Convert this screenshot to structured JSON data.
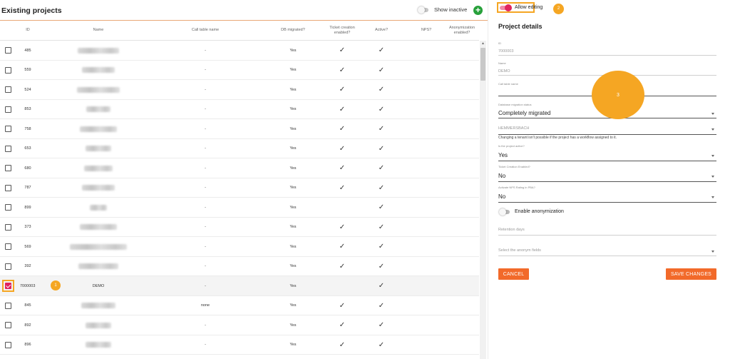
{
  "left": {
    "title": "Existing projects",
    "show_inactive_label": "Show inactive",
    "add_symbol": "+",
    "columns": {
      "id": "ID",
      "name": "Name",
      "call_table": "Call table name",
      "db_migrated": "DB migrated?",
      "ticket": "Ticket creation enabled?",
      "active": "Active?",
      "nps": "NPS?",
      "anonymization": "Anonymization enabled?"
    },
    "rows": [
      {
        "id": "485",
        "name": "",
        "blur_w": 58,
        "call_table": "-",
        "db": "Yes",
        "ticket": true,
        "active": true
      },
      {
        "id": "559",
        "name": "",
        "blur_w": 46,
        "call_table": "-",
        "db": "Yes",
        "ticket": true,
        "active": true
      },
      {
        "id": "524",
        "name": "",
        "blur_w": 60,
        "call_table": "-",
        "db": "Yes",
        "ticket": true,
        "active": true
      },
      {
        "id": "853",
        "name": "",
        "blur_w": 34,
        "call_table": "-",
        "db": "Yes",
        "ticket": true,
        "active": true
      },
      {
        "id": "758",
        "name": "",
        "blur_w": 52,
        "call_table": "-",
        "db": "Yes",
        "ticket": true,
        "active": true
      },
      {
        "id": "653",
        "name": "",
        "blur_w": 36,
        "call_table": "-",
        "db": "Yes",
        "ticket": true,
        "active": true
      },
      {
        "id": "680",
        "name": "",
        "blur_w": 40,
        "call_table": "-",
        "db": "Yes",
        "ticket": true,
        "active": true
      },
      {
        "id": "787",
        "name": "",
        "blur_w": 46,
        "call_table": "-",
        "db": "Yes",
        "ticket": true,
        "active": true
      },
      {
        "id": "899",
        "name": "",
        "blur_w": 24,
        "call_table": "-",
        "db": "Yes",
        "ticket": false,
        "active": true
      },
      {
        "id": "373",
        "name": "",
        "blur_w": 52,
        "call_table": "-",
        "db": "Yes",
        "ticket": true,
        "active": true
      },
      {
        "id": "569",
        "name": "",
        "blur_w": 84,
        "call_table": "-",
        "db": "Yes",
        "ticket": true,
        "active": true
      },
      {
        "id": "392",
        "name": "",
        "blur_w": 56,
        "call_table": "-",
        "db": "Yes",
        "ticket": true,
        "active": true
      },
      {
        "id": "7000003",
        "name": "DEMO",
        "blur_w": 0,
        "call_table": "-",
        "db": "Yes",
        "ticket": false,
        "active": true,
        "selected": true,
        "badge": "1"
      },
      {
        "id": "845",
        "name": "",
        "blur_w": 48,
        "call_table": "none",
        "db": "Yes",
        "ticket": true,
        "active": true
      },
      {
        "id": "892",
        "name": "",
        "blur_w": 36,
        "call_table": "-",
        "db": "Yes",
        "ticket": true,
        "active": true
      },
      {
        "id": "896",
        "name": "",
        "blur_w": 36,
        "call_table": "-",
        "db": "Yes",
        "ticket": true,
        "active": true
      }
    ],
    "check_symbol": "✓"
  },
  "right": {
    "allow_editing_label": "Allow editing",
    "badge2": "2",
    "title": "Project details",
    "fields": {
      "id_label": "ID",
      "id_value": "7000003",
      "name_label": "Name",
      "name_value": "DEMO",
      "call_table_label": "Call table name",
      "db_status_label": "Database migration status",
      "db_status_value": "Completely migrated",
      "tenant_value": "HEMMERSBACH",
      "tenant_note": "Changing a tenant isn't possible if the project has a workflow assigned to it.",
      "active_label": "Is the project active?",
      "active_value": "Yes",
      "ticket_label": "Ticket Creation Enabled?",
      "ticket_value": "No",
      "nps_label": "Activate NPS Rating in PBA?",
      "nps_value": "No",
      "anonymization_label": "Enable anonymization",
      "retention_placeholder": "Retention days",
      "anonym_fields_placeholder": "Select the anonym fields"
    },
    "cancel_label": "CANCEL",
    "save_label": "SAVE CHANGES"
  },
  "badge3": "3",
  "colors": {
    "accent": "#f26a2a",
    "toggle_on": "#e0245e",
    "annotation": "#f5a623",
    "add": "#27a03a"
  }
}
